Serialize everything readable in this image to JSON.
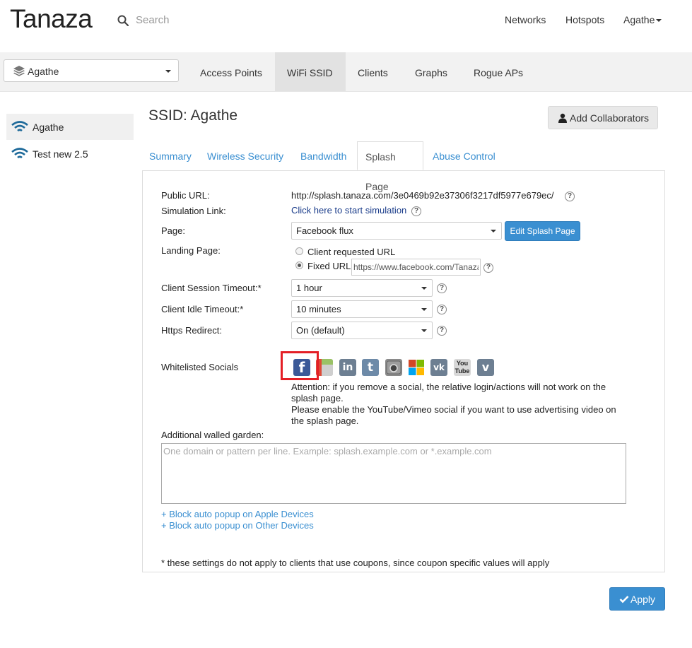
{
  "brand": "Tanaza",
  "search": {
    "placeholder": "Search"
  },
  "topnav": {
    "networks": "Networks",
    "hotspots": "Hotspots",
    "user": "Agathe"
  },
  "network_select": {
    "value": "Agathe"
  },
  "main_tabs": [
    "Access Points",
    "WiFi SSID",
    "Clients",
    "Graphs",
    "Rogue APs"
  ],
  "sidebar": {
    "items": [
      {
        "label": "Agathe"
      },
      {
        "label": "Test new 2.5"
      }
    ]
  },
  "page_title": "SSID: Agathe",
  "add_collaborators": "Add Collaborators",
  "content_tabs": [
    "Summary",
    "Wireless Security",
    "Bandwidth",
    "Splash Page",
    "Abuse Control"
  ],
  "form": {
    "public_url": {
      "label": "Public URL:",
      "value": "http://splash.tanaza.com/3e0469b92e37306f3217df5977e679ec/"
    },
    "simulation": {
      "label": "Simulation Link:",
      "value": "Click here to start simulation"
    },
    "page": {
      "label": "Page:",
      "value": "Facebook flux",
      "edit_button": "Edit Splash Page"
    },
    "landing": {
      "label": "Landing Page:",
      "option1": "Client requested URL",
      "option2": "Fixed URL",
      "fixed_url_value": "https://www.facebook.com/Tanaza"
    },
    "session_timeout": {
      "label": "Client Session Timeout:*",
      "value": "1 hour"
    },
    "idle_timeout": {
      "label": "Client Idle Timeout:*",
      "value": "10 minutes"
    },
    "https_redirect": {
      "label": "Https Redirect:",
      "value": "On (default)"
    },
    "socials": {
      "label": "Whitelisted Socials",
      "icons": [
        "facebook-icon",
        "google-plus-icon",
        "linkedin-icon",
        "twitter-icon",
        "instagram-icon",
        "windows-live-icon",
        "vk-icon",
        "youtube-icon",
        "vimeo-icon"
      ],
      "note1": "Attention: if you remove a social, the relative login/actions will not work on the splash page.",
      "note2": "Please enable the YouTube/Vimeo social if you want to use advertising video on the splash page."
    },
    "walled_garden": {
      "label": "Additional walled garden:",
      "placeholder": "One domain or pattern per line. Example: splash.example.com or *.example.com"
    },
    "links": {
      "apple": "+ Block auto popup on Apple Devices",
      "other": "+ Block auto popup on Other Devices"
    },
    "footnote": "* these settings do not apply to clients that use coupons, since coupon specific values will apply"
  },
  "apply_button": "Apply",
  "colors": {
    "accent": "#3a8fd1",
    "highlight": "#e41f26",
    "wifi": "#1e6a9a"
  }
}
